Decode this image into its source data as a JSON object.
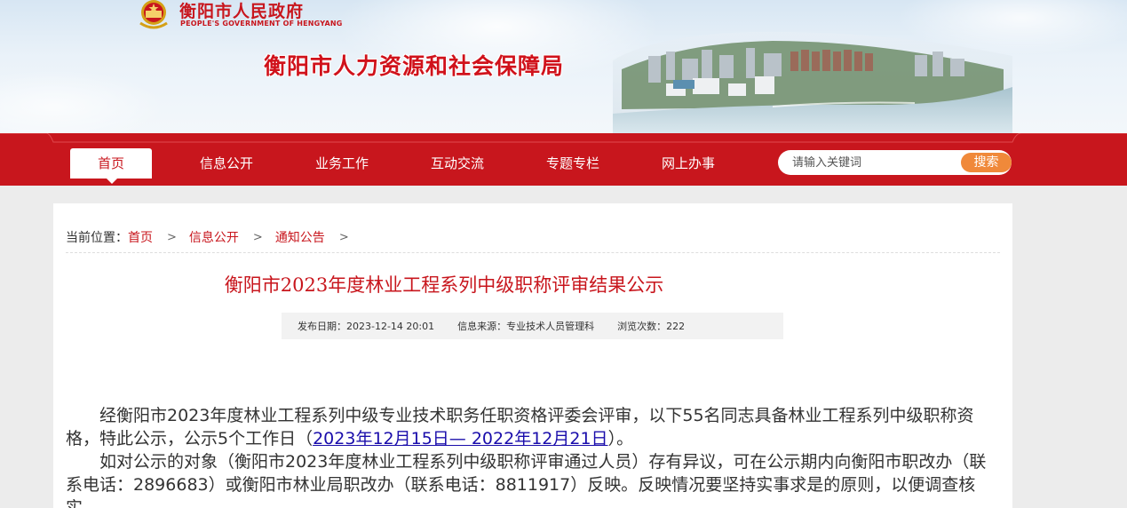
{
  "header": {
    "gov_name": "衡阳市人民政府",
    "gov_en": "PEOPLE'S GOVERNMENT OF HENGYANG",
    "bureau_name": "衡阳市人力资源和社会保障局",
    "emblem_icon": "national-emblem-icon",
    "photo": "city-skyline-photo"
  },
  "nav": {
    "items": [
      {
        "label": "首页",
        "active": true
      },
      {
        "label": "信息公开"
      },
      {
        "label": "业务工作"
      },
      {
        "label": "互动交流"
      },
      {
        "label": "专题专栏"
      },
      {
        "label": "网上办事"
      }
    ],
    "search": {
      "placeholder": "请输入关键词",
      "button": "搜索"
    }
  },
  "breadcrumb": {
    "prefix": "当前位置：",
    "items": [
      "首页",
      "信息公开",
      "通知公告"
    ]
  },
  "article": {
    "title": "衡阳市2023年度林业工程系列中级职称评审结果公示",
    "meta": {
      "publish_date": "发布日期：2023-12-14 20:01",
      "source": "信息来源：专业技术人员管理科",
      "views": "浏览次数：222"
    },
    "p1_a": "经衡阳市2023年度林业工程系列中级专业技术职务任职资格评委会评审，以下55名同志具备林业工程系列中级职称资格，特此公示，公示5个工作日（",
    "p1_link": "2023年12月15日— 2022年12月21日",
    "p1_b": "）。",
    "p2": "如对公示的对象（衡阳市2023年度林业工程系列中级职称评审通过人员）存有异议，可在公示期内向衡阳市职改办（联系电话：2896683）或衡阳市林业局职改办（联系电话：8811917）反映。反映情况要坚持实事求是的原则，以便调查核实。"
  },
  "colors": {
    "brand_red": "#c8161d",
    "search_orange": "#f0893a",
    "link_blue": "#1a0dab"
  }
}
